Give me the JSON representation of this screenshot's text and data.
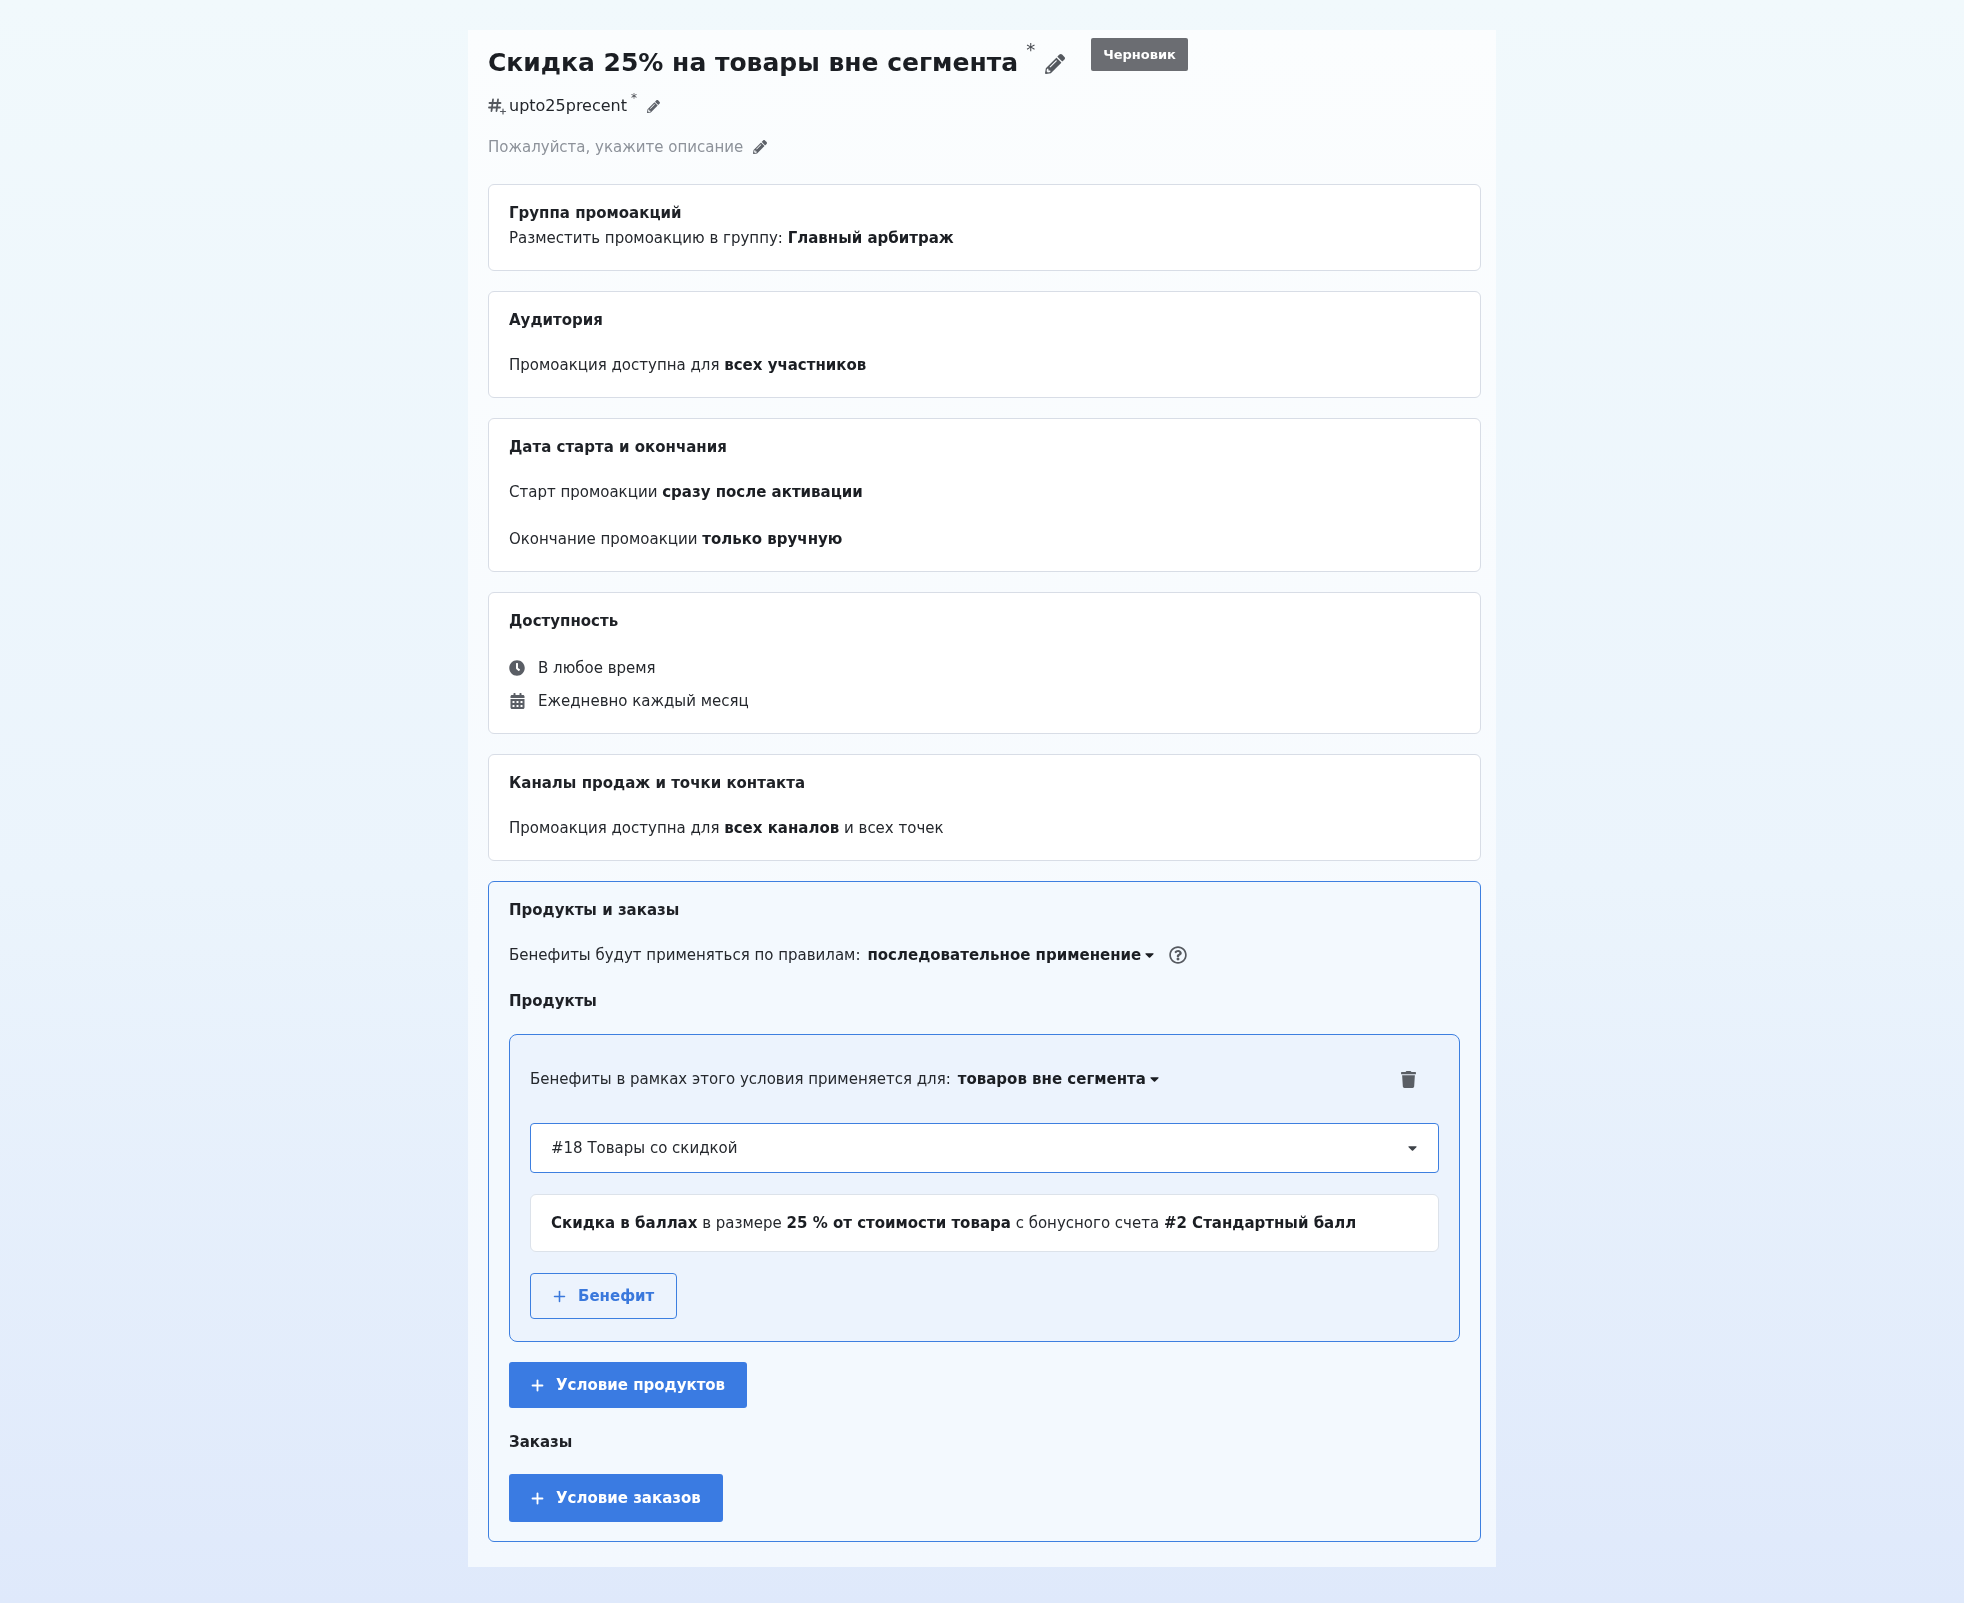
{
  "header": {
    "title": "Скидка 25% на товары вне сегмента",
    "title_mark": "*",
    "status": "Черновик",
    "code": "upto25precent",
    "code_mark": "*",
    "description": {
      "placeholder": "Пожалуйста, укажите описание"
    }
  },
  "sections": [
    {
      "kind": "summary",
      "active": false,
      "title": "Группа промоакций",
      "lines": [
        "Разместить промоакцию в группу: **Главный арбитраж**"
      ]
    },
    {
      "kind": "text",
      "active": false,
      "title": "Аудитория",
      "lines": [
        "Промоакция доступна для **всех участников**"
      ]
    },
    {
      "kind": "text",
      "active": false,
      "title": "Дата старта и окончания",
      "lines": [
        "Старт промоакции **сразу после активации**",
        "Окончание промоакции **только вручную**"
      ]
    },
    {
      "kind": "schedule",
      "active": false,
      "title": "Доступность",
      "items": [
        {
          "kind": "hours",
          "text": "В любое время"
        },
        {
          "kind": "dates",
          "text": "Ежедневно каждый месяц"
        }
      ]
    },
    {
      "kind": "text",
      "active": false,
      "title": "Каналы продаж и точки контакта",
      "lines": [
        "Промоакция доступна для **всех каналов** и всех точек"
      ]
    },
    {
      "kind": "products",
      "active": true,
      "title": "Продукты и заказы",
      "rule_label": "Бенефиты будут применяться по правилам:",
      "rule_value": "последовательное применение",
      "products_heading": "Продукты",
      "conditions": [
        {
          "scope_label": "Бенефиты в рамках этого условия применяется для:",
          "scope_value": "товаров вне сегмента",
          "segment": {
            "value": "#18 Товары со скидкой"
          },
          "benefits": [
            "**Скидка в баллах** в размере **25 % от стоимости товара** с бонусного счета **#2 Стандартный балл**"
          ],
          "add_benefit": "Бенефит"
        }
      ],
      "add_product_condition": "Условие продуктов",
      "orders_heading": "Заказы",
      "add_order_condition": "Условие заказов"
    }
  ]
}
